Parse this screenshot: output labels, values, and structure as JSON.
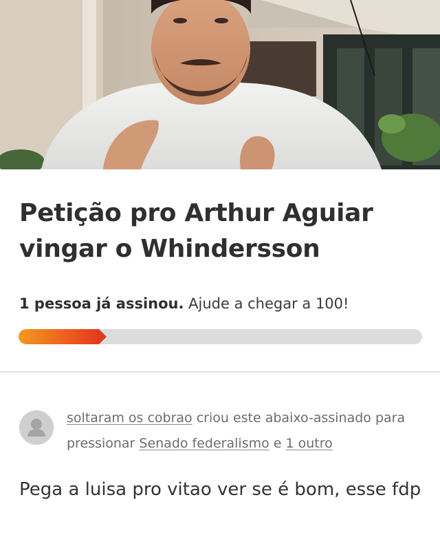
{
  "hero": {
    "image": "man-in-white-shirt-photo"
  },
  "petition": {
    "title": "Petição pro Arthur Aguiar vingar o Whindersson",
    "signatures_strong": "1 pessoa já assinou.",
    "signatures_rest": " Ajude a chegar a 100!",
    "progress_fraction": 0.2,
    "progress_colors": [
      "#f29a1f",
      "#e23a1f"
    ]
  },
  "creator": {
    "name": "soltaram os cobrao",
    "text_created": " criou este abaixo-assinado para pressionar ",
    "target": "Senado federalismo",
    "conjunction": " e ",
    "others": "1 outro"
  },
  "description": {
    "text": "Pega a luisa pro vitao ver se é bom, esse fdp"
  },
  "icons": {
    "avatar": "default-user-avatar-icon"
  }
}
